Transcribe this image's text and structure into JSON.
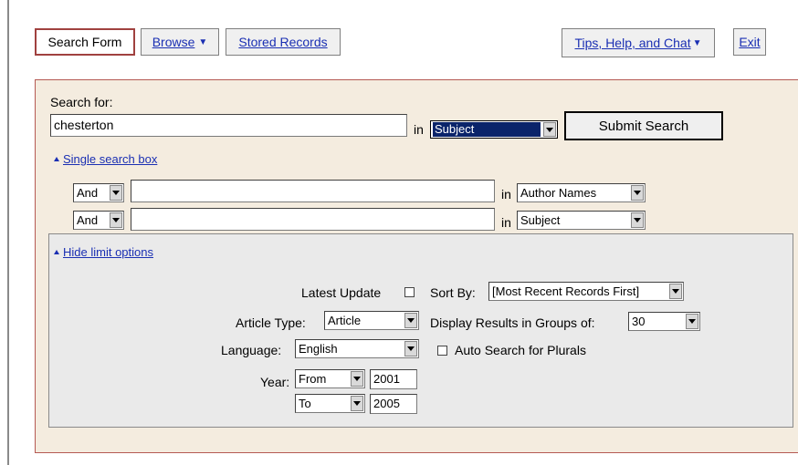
{
  "toolbar": {
    "search_form": "Search Form",
    "browse": "Browse",
    "stored_records": "Stored Records",
    "tips": "Tips, Help, and Chat",
    "exit": "Exit"
  },
  "search": {
    "label": "Search for:",
    "query": "chesterton",
    "in": "in",
    "field": "Subject",
    "submit": "Submit Search",
    "single_box_link": "Single search box",
    "rows": [
      {
        "op": "And",
        "value": "",
        "in": "in",
        "field": "Author Names"
      },
      {
        "op": "And",
        "value": "",
        "in": "in",
        "field": "Subject"
      }
    ]
  },
  "limits": {
    "hide_link": "Hide limit options",
    "latest_update": "Latest Update",
    "article_type_label": "Article Type:",
    "article_type": "Article",
    "language_label": "Language:",
    "language": "English",
    "year_label": "Year:",
    "year_from_op": "From",
    "year_from": "2001",
    "year_to_op": "To",
    "year_to": "2005",
    "sort_by_label": "Sort By:",
    "sort_by": "[Most Recent Records First]",
    "display_label": "Display Results in Groups of:",
    "display": "30",
    "plurals": "Auto Search for Plurals"
  }
}
